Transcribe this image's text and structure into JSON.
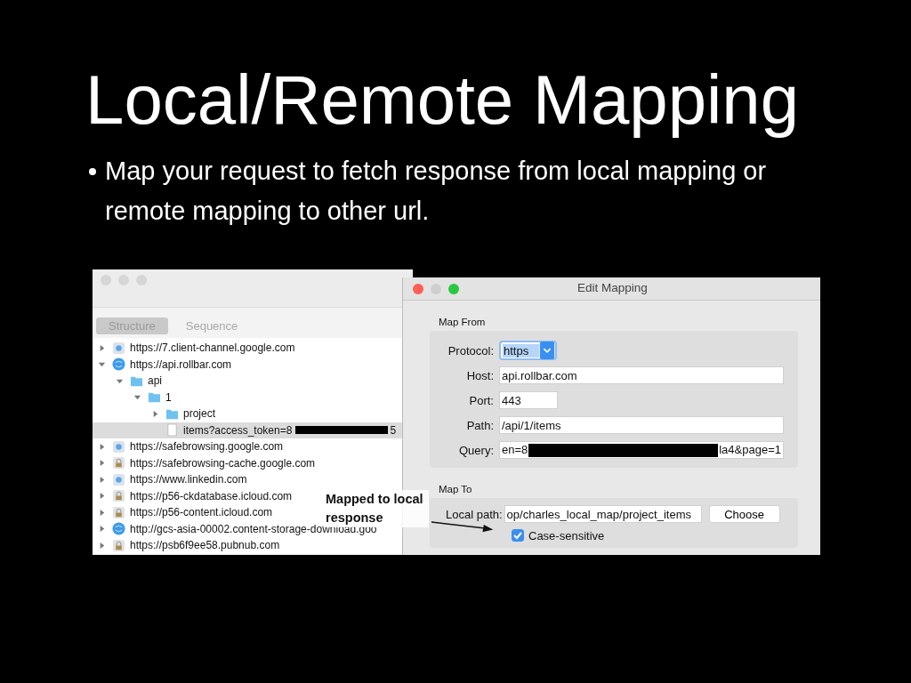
{
  "slide": {
    "title": "Local/Remote Mapping",
    "bullets": [
      "Map your request to fetch response from local mapping or remote mapping to other url."
    ]
  },
  "main_window": {
    "tabs": [
      {
        "label": "Structure",
        "selected": true
      },
      {
        "label": "Sequence",
        "selected": false
      }
    ],
    "tree": [
      {
        "label": "https://7.client-channel.google.com",
        "kind": "globe_pale",
        "expanded": false,
        "selected": false
      },
      {
        "label": "https://api.rollbar.com",
        "kind": "globe",
        "expanded": true,
        "selected": false,
        "children": [
          {
            "label": "api",
            "kind": "folder",
            "expanded": true,
            "selected": false,
            "children": [
              {
                "label": "1",
                "kind": "folder",
                "expanded": true,
                "selected": false,
                "children": [
                  {
                    "label": "project",
                    "kind": "folder",
                    "expanded": false,
                    "selected": false
                  },
                  {
                    "label": "items?access_token=8",
                    "redacted_suffix": "5",
                    "kind": "file",
                    "selected": true
                  }
                ]
              }
            ]
          }
        ]
      },
      {
        "label": "https://safebrowsing.google.com",
        "kind": "globe_pale",
        "expanded": false,
        "selected": false
      },
      {
        "label": "https://safebrowsing-cache.google.com",
        "kind": "lock",
        "expanded": false,
        "selected": false
      },
      {
        "label": "https://www.linkedin.com",
        "kind": "globe_pale",
        "expanded": false,
        "selected": false
      },
      {
        "label": "https://p56-ckdatabase.icloud.com",
        "kind": "lock",
        "expanded": false,
        "selected": false
      },
      {
        "label": "https://p56-content.icloud.com",
        "kind": "lock",
        "expanded": false,
        "selected": false
      },
      {
        "label": "http://gcs-asia-00002.content-storage-download.goo",
        "kind": "globe",
        "expanded": false,
        "selected": false
      },
      {
        "label": "https://psb6f9ee58.pubnub.com",
        "kind": "lock",
        "expanded": false,
        "selected": false
      }
    ]
  },
  "dialog": {
    "title": "Edit Mapping",
    "map_from": {
      "label": "Map From",
      "protocol": {
        "label": "Protocol:",
        "value": "https"
      },
      "fields": [
        {
          "label": "Host:",
          "value": "api.rollbar.com",
          "kind": "text"
        },
        {
          "label": "Port:",
          "value": "443",
          "kind": "number"
        },
        {
          "label": "Path:",
          "value": "/api/1/items",
          "kind": "text"
        },
        {
          "label": "Query:",
          "value": "en=8",
          "redacted_suffix": "la4&page=1",
          "kind": "redacted"
        }
      ]
    },
    "map_to": {
      "label": "Map To",
      "local_path": {
        "label": "Local path:",
        "value": "op/charles_local_map/project_items"
      },
      "choose_button": "Choose",
      "case_sensitive": {
        "label": "Case-sensitive",
        "checked": true
      }
    }
  },
  "annotation": {
    "text": "Mapped to local response"
  }
}
